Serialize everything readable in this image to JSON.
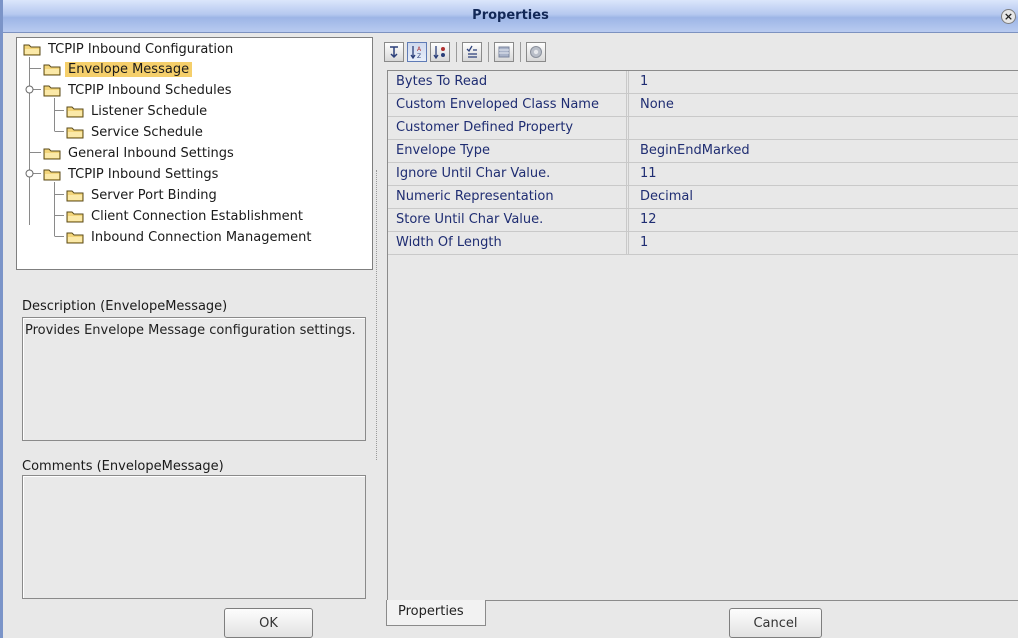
{
  "window": {
    "title": "Properties",
    "close_glyph": "×"
  },
  "tree": {
    "root": "TCPIP Inbound Configuration",
    "items": [
      {
        "label": "Envelope Message",
        "selected": true
      },
      {
        "label": "TCPIP Inbound Schedules",
        "expandable": true
      },
      {
        "label": "Listener Schedule"
      },
      {
        "label": "Service Schedule"
      },
      {
        "label": "General Inbound Settings"
      },
      {
        "label": "TCPIP Inbound Settings",
        "expandable": true
      },
      {
        "label": "Server Port Binding"
      },
      {
        "label": "Client Connection Establishment"
      },
      {
        "label": "Inbound Connection Management"
      }
    ]
  },
  "description": {
    "label": "Description (EnvelopeMessage)",
    "text": "Provides Envelope Message configuration settings."
  },
  "comments": {
    "label": "Comments (EnvelopeMessage)",
    "text": ""
  },
  "toolbar": {
    "icons": [
      "sort-category-icon",
      "sort-alpha-icon",
      "sort-property-icon",
      "show-editable-icon",
      "customize-icon",
      "help-icon"
    ]
  },
  "properties": [
    {
      "name": "Bytes To Read",
      "value": "1"
    },
    {
      "name": "Custom Enveloped Class Name",
      "value": "None"
    },
    {
      "name": "Customer Defined Property",
      "value": ""
    },
    {
      "name": "Envelope Type",
      "value": "BeginEndMarked"
    },
    {
      "name": "Ignore Until Char Value.",
      "value": "11"
    },
    {
      "name": "Numeric Representation",
      "value": "Decimal"
    },
    {
      "name": "Store Until Char Value.",
      "value": "12"
    },
    {
      "name": "Width Of Length",
      "value": "1"
    }
  ],
  "tabs": {
    "properties": "Properties"
  },
  "buttons": {
    "ok": "OK",
    "cancel": "Cancel"
  },
  "colors": {
    "title_text": "#122857",
    "property_text": "#1f2d72",
    "selection": "#f5cf6b",
    "folder": "#f3d57a"
  }
}
